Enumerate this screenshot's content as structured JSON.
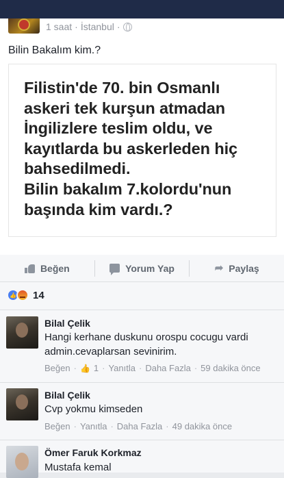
{
  "post": {
    "time": "1 saat",
    "location": "İstanbul",
    "separator": "·",
    "text": "Bilin Bakalım kim.?",
    "image_text": "Filistin'de 70. bin Osmanlı\naskeri tek kurşun atmadan\nİngilizlere teslim oldu, ve\nkayıtlarda bu askerleden hiç\nbahsedilmedi.\nBilin bakalım 7.kolordu'nun\nbaşında kim vardı.?"
  },
  "actions": {
    "like": "Beğen",
    "comment": "Yorum Yap",
    "share": "Paylaş"
  },
  "reactions": {
    "count": "14"
  },
  "comments": [
    {
      "name": "Bilal Çelik",
      "text": "Hangi kerhane duskunu orospu cocugu vardi admin.cevaplarsan sevinirim.",
      "like": "Beğen",
      "likes": "1",
      "reply": "Yanıtla",
      "more": "Daha Fazla",
      "time": "59 dakika önce"
    },
    {
      "name": "Bilal Çelik",
      "text": "Cvp yokmu kimseden",
      "like": "Beğen",
      "reply": "Yanıtla",
      "more": "Daha Fazla",
      "time": "49 dakika önce"
    },
    {
      "name": "Ömer Faruk Korkmaz",
      "text": "Mustafa kemal"
    }
  ]
}
